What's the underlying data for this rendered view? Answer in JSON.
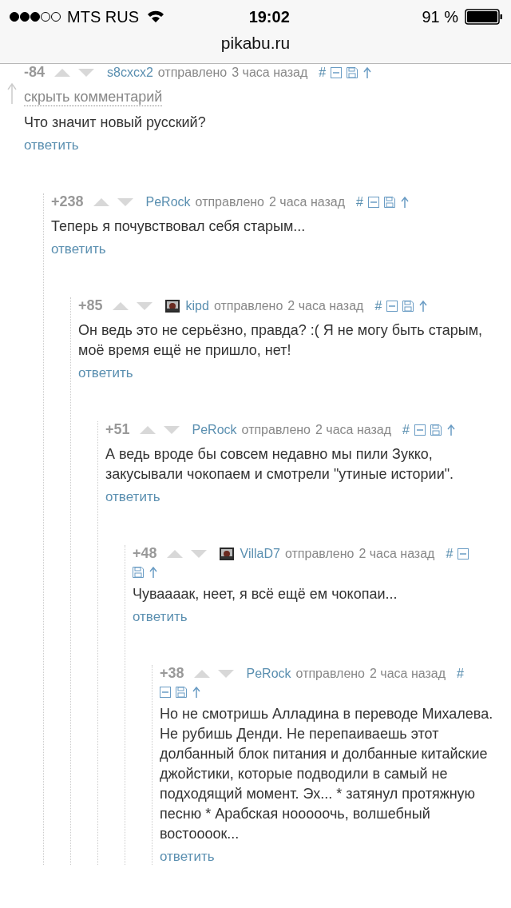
{
  "status_bar": {
    "carrier": "MTS RUS",
    "time": "19:02",
    "battery": "91 %"
  },
  "url": "pikabu.ru",
  "comments": [
    {
      "score": "-84",
      "author": "s8cxcx2",
      "sent": "отправлено",
      "time": "3 часа назад",
      "anchor": "#",
      "avatar": false,
      "hide_link": "скрыть комментарий",
      "text": "Что значит новый русский?",
      "reply": "ответить",
      "children": [
        {
          "score": "+238",
          "author": "PeRock",
          "sent": "отправлено",
          "time": "2 часа назад",
          "anchor": "#",
          "avatar": false,
          "text": "Теперь я почувствовал себя старым...",
          "reply": "ответить",
          "children": [
            {
              "score": "+85",
              "author": "kipd",
              "sent": "отправлено",
              "time": "2 часа назад",
              "anchor": "#",
              "avatar": true,
              "text": "Он ведь это не серьёзно, правда? :( Я не могу быть старым, моё время ещё не пришло, нет!",
              "reply": "ответить",
              "children": [
                {
                  "score": "+51",
                  "author": "PeRock",
                  "sent": "отправлено",
                  "time": "2 часа назад",
                  "anchor": "#",
                  "avatar": false,
                  "text": "А ведь вроде бы совсем недавно мы пили Зукко, закусывали чокопаем и смотрели \"утиные истории\".",
                  "reply": "ответить",
                  "children": [
                    {
                      "score": "+48",
                      "author": "VillaD7",
                      "sent": "отправлено",
                      "time": "2 часа назад",
                      "anchor": "#",
                      "avatar": true,
                      "text": "Чуваааак, неет, я всё ещё ем чокопаи...",
                      "reply": "ответить",
                      "children": [
                        {
                          "score": "+38",
                          "author": "PeRock",
                          "sent": "отправлено",
                          "time": "2 часа назад",
                          "anchor": "#",
                          "avatar": false,
                          "text": "Но не смотришь Алладина в переводе Михалева. Не рубишь Денди. Не перепаиваешь этот долбанный блок питания и долбанные китайские джойстики, которые подводили в самый не подходящий момент. Эх... * затянул протяжную песню * Арабская нооооочь, волшебный востоооок...",
                          "reply": "ответить"
                        }
                      ]
                    }
                  ]
                }
              ]
            }
          ]
        }
      ]
    }
  ]
}
